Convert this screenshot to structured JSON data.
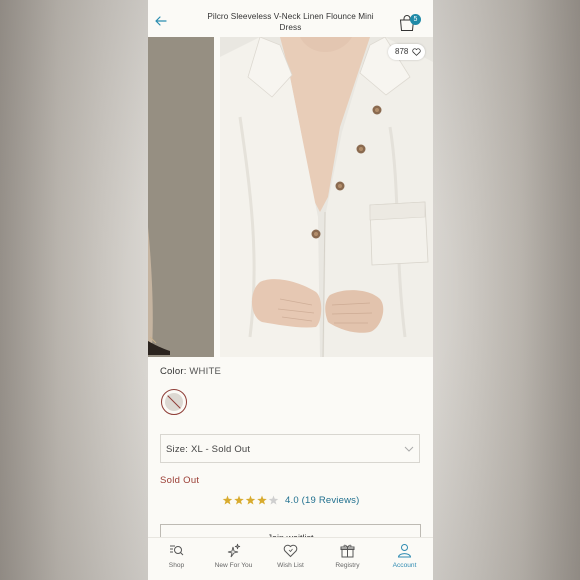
{
  "header": {
    "title": "Pilcro Sleeveless V-Neck Linen Flounce Mini Dress",
    "bag_count": "5",
    "accent_color": "#1f8aa7"
  },
  "gallery": {
    "likes_count": "878"
  },
  "product": {
    "color_label": "Color:",
    "color_value": "WHITE",
    "size_label": "Size:",
    "size_value": "XL - Sold Out",
    "stock_status": "Sold Out",
    "rating": 4.0,
    "rating_text": "4.0 (19 Reviews)",
    "waitlist_label": "Join waitlist"
  },
  "nav": {
    "items": [
      {
        "label": "Shop",
        "icon": "search-list-icon"
      },
      {
        "label": "New For You",
        "icon": "sparkles-icon"
      },
      {
        "label": "Wish List",
        "icon": "heart-icon"
      },
      {
        "label": "Registry",
        "icon": "gift-icon"
      },
      {
        "label": "Account",
        "icon": "person-icon",
        "active": true
      }
    ]
  }
}
